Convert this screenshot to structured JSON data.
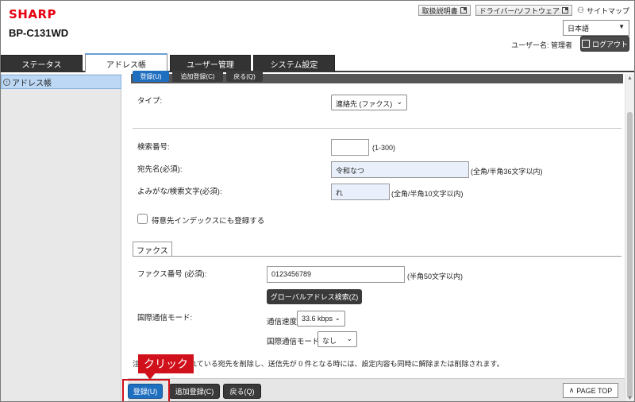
{
  "header": {
    "logo": "SHARP",
    "model": "BP-C131WD",
    "links": [
      "取扱説明書",
      "ドライバー/ソフトウェア"
    ],
    "sitemap": "サイトマップ",
    "language": "日本語",
    "user_label": "ユーザー名: 管理者",
    "logout": "ログアウト"
  },
  "tabs": [
    "ステータス",
    "アドレス帳",
    "ユーザー管理",
    "システム設定"
  ],
  "sidebar": {
    "items": [
      "アドレス帳"
    ]
  },
  "top_buttons": [
    "登録(U)",
    "追加登録(C)",
    "戻る(Q)"
  ],
  "form": {
    "type_label": "タイプ:",
    "type_value": "連絡先 (ファクス)",
    "search_no_label": "検索番号:",
    "search_no_value": "",
    "search_no_hint": "(1-300)",
    "name_label": "宛先名(必須):",
    "name_value": "令和なつ",
    "name_hint": "(全角/半角36文字以内)",
    "kana_label": "よみがな/検索文字(必須):",
    "kana_value": "れ",
    "kana_hint": "(全角/半角10文字以内)",
    "favorite_label": "得意先インデックスにも登録する"
  },
  "fax": {
    "tab": "ファクス",
    "number_label": "ファクス番号 (必須):",
    "number_value": "0123456789",
    "number_hint": "(半角50文字以内)",
    "global_search": "グローバルアドレス検索(Z)",
    "intl_mode_label": "国際通信モード:",
    "speed_label": "通信速度:",
    "speed_value": "33.6 kbps",
    "intl_mode_sub_label": "国際通信モード:",
    "intl_mode_value": "なし"
  },
  "note": "注　　　　　録されている宛先を削除し、送信先が 0 件となる時には、設定内容も同時に解除または削除されます。",
  "bottom_buttons": [
    "登録(U)",
    "追加登録(C)",
    "戻る(Q)"
  ],
  "page_top": "PAGE TOP",
  "callout": "クリック"
}
